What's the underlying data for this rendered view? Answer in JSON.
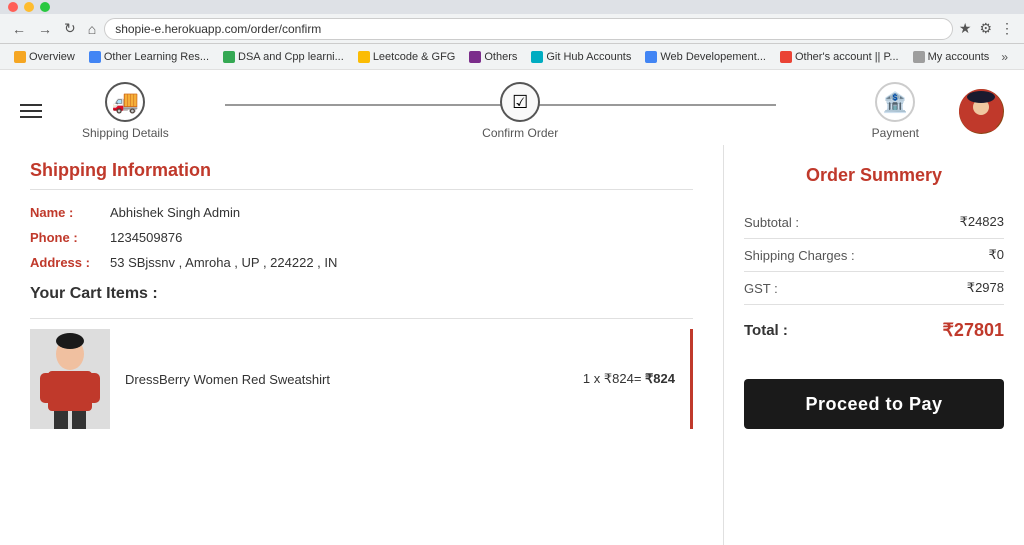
{
  "browser": {
    "url": "shopie-e.herokuapp.com/order/confirm",
    "bookmarks": [
      {
        "label": "Overview",
        "color": "bm-orange"
      },
      {
        "label": "Other Learning Res...",
        "color": "bm-blue"
      },
      {
        "label": "DSA and Cpp learni...",
        "color": "bm-green"
      },
      {
        "label": "Leetcode & GFG",
        "color": "bm-yellow"
      },
      {
        "label": "Others",
        "color": "bm-purple"
      },
      {
        "label": "Git Hub Accounts",
        "color": "bm-teal"
      },
      {
        "label": "Web Developement...",
        "color": "bm-blue"
      },
      {
        "label": "Other's account || P...",
        "color": "bm-red"
      },
      {
        "label": "My accounts",
        "color": "bm-gray"
      }
    ]
  },
  "steps": [
    {
      "label": "Shipping Details",
      "icon": "🚚",
      "state": "active"
    },
    {
      "label": "Confirm Order",
      "icon": "☑",
      "state": "active"
    },
    {
      "label": "Payment",
      "icon": "🏦",
      "state": "inactive"
    }
  ],
  "shipping": {
    "title": "Shipping Information",
    "name_label": "Name :",
    "name_value": "Abhishek Singh Admin",
    "phone_label": "Phone :",
    "phone_value": "1234509876",
    "address_label": "Address :",
    "address_value": "53 SBjssnv , Amroha , UP , 224222 , IN"
  },
  "cart": {
    "title": "Your Cart Items :",
    "items": [
      {
        "name": "DressBerry Women Red Sweatshirt",
        "quantity": "1",
        "unit_price": "824",
        "total": "₹824",
        "quantity_display": "1 x ₹824= ₹824"
      }
    ]
  },
  "order_summary": {
    "title": "Order Summery",
    "subtotal_label": "Subtotal :",
    "subtotal_value": "₹24823",
    "shipping_label": "Shipping Charges :",
    "shipping_value": "₹0",
    "gst_label": "GST :",
    "gst_value": "₹2978",
    "total_label": "Total :",
    "total_value": "₹27801",
    "proceed_btn": "Proceed to Pay"
  }
}
